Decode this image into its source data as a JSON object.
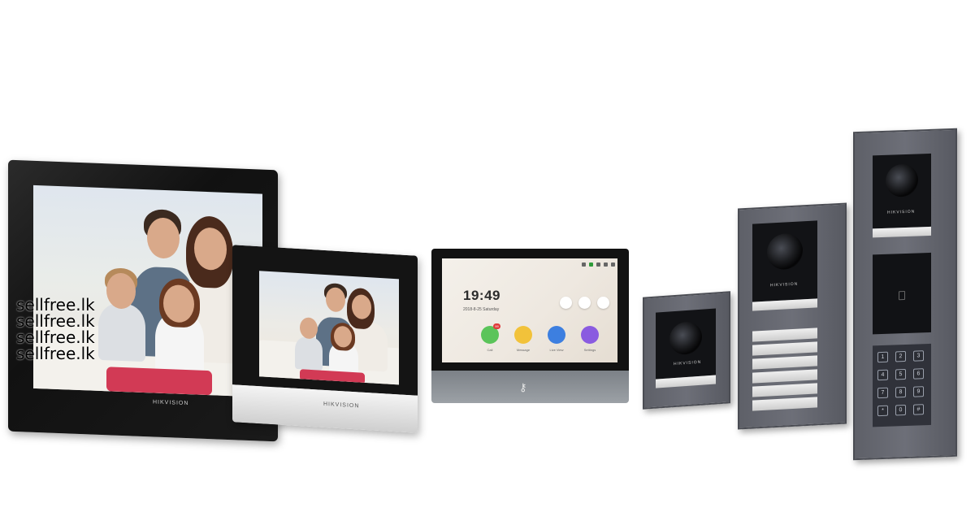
{
  "watermark": {
    "lines": [
      "sellfree.lk",
      "sellfree.lk",
      "sellfree.lk",
      "sellfree.lk"
    ]
  },
  "monitors": [
    {
      "brand": "HIKVISION"
    },
    {
      "brand": "HIKVISION"
    },
    {
      "home_screen": {
        "time": "19:49",
        "date": "2018-8-25  Saturday",
        "apps": [
          {
            "label": "Call",
            "color": "#5bc45a",
            "icon": "phone-icon"
          },
          {
            "label": "Message",
            "color": "#f2c23a",
            "icon": "envelope-icon"
          },
          {
            "label": "Live View",
            "color": "#3d7fe0",
            "icon": "eye-icon"
          },
          {
            "label": "Settings",
            "color": "#8a5be0",
            "icon": "gear-icon"
          }
        ],
        "call_badge": "99"
      },
      "unlock_icon": "key-icon"
    }
  ],
  "door_stations": [
    {
      "brand": "HIKVISION"
    },
    {
      "brand": "HIKVISION"
    },
    {
      "brand": "HIKVISION"
    }
  ],
  "keypad": [
    "1",
    "2",
    "3",
    "4",
    "5",
    "6",
    "7",
    "8",
    "9",
    "*",
    "0",
    "#"
  ]
}
